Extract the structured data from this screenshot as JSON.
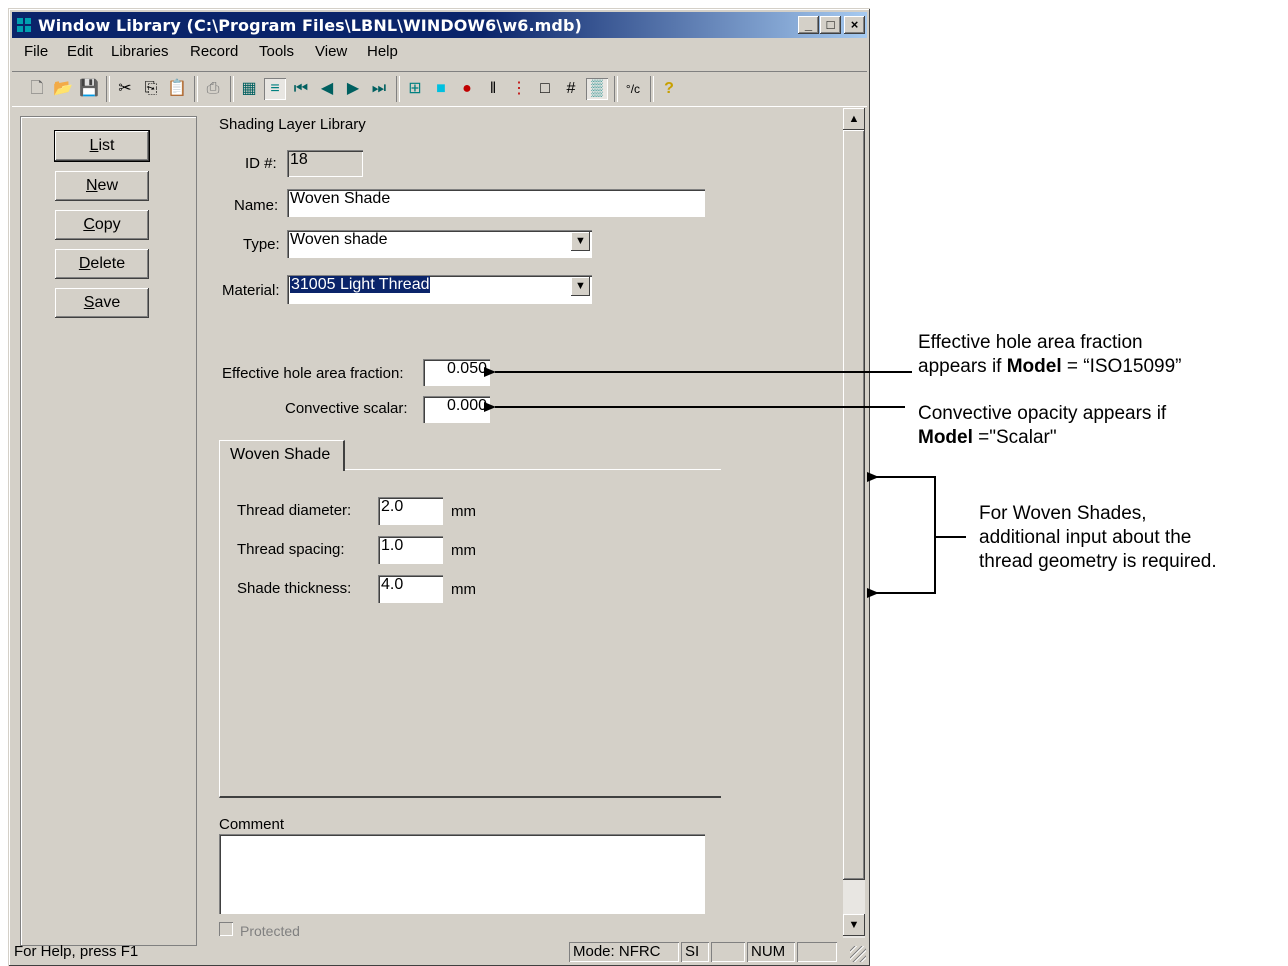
{
  "window": {
    "title": "Window Library (C:\\Program Files\\LBNL\\WINDOW6\\w6.mdb)",
    "min_label": "_",
    "max_label": "□",
    "close_label": "×"
  },
  "menu": [
    "File",
    "Edit",
    "Libraries",
    "Record",
    "Tools",
    "View",
    "Help"
  ],
  "toolbar_icons": [
    "new-file-icon",
    "open-folder-icon",
    "save-icon",
    "cut-icon",
    "copy-icon",
    "paste-icon",
    "print-icon",
    "grid-view-icon",
    "list-view-icon",
    "first-record-icon",
    "prev-record-icon",
    "next-record-icon",
    "last-record-icon",
    "glazing-icon",
    "color-icon",
    "pin-icon",
    "columns-icon",
    "marker-icon",
    "frame-icon",
    "hash-icon",
    "shade-icon",
    "temperature-unit-icon",
    "help-icon"
  ],
  "left_buttons": {
    "list": {
      "u": "L",
      "rest": "ist"
    },
    "new": {
      "u": "N",
      "rest": "ew"
    },
    "copy": {
      "u": "C",
      "rest": "opy"
    },
    "delete": {
      "u": "D",
      "rest": "elete"
    },
    "save": {
      "u": "S",
      "rest": "ave"
    }
  },
  "form": {
    "section_title": "Shading Layer Library",
    "id_label": "ID #:",
    "id_value": "18",
    "name_label": "Name:",
    "name_value": "Woven Shade",
    "type_label": "Type:",
    "type_value": "Woven shade",
    "material_label": "Material:",
    "material_value": "31005 Light Thread",
    "hole_fraction_label": "Effective hole area fraction:",
    "hole_fraction_value": "0.050",
    "convective_label": "Convective scalar:",
    "convective_value": "0.000"
  },
  "tab": {
    "label": "Woven Shade",
    "thread_diameter_label": "Thread diameter:",
    "thread_diameter_value": "2.0",
    "thread_spacing_label": "Thread spacing:",
    "thread_spacing_value": "1.0",
    "shade_thickness_label": "Shade thickness:",
    "shade_thickness_value": "4.0",
    "unit": "mm"
  },
  "comment": {
    "label": "Comment",
    "value": "",
    "protected_label": "Protected"
  },
  "status": {
    "help": "For Help, press F1",
    "mode": "Mode: NFRC",
    "units": "SI",
    "num": "NUM"
  },
  "annotations": {
    "hole_line1": "Effective hole area fraction",
    "hole_line2_pre": "appears if ",
    "hole_line2_bold": "Model",
    "hole_line2_post": " = “ISO15099”",
    "conv_line1": "Convective opacity appears if",
    "conv_line2_bold": "Model",
    "conv_line2_post": " =\"Scalar\"",
    "woven_line1": "For Woven Shades,",
    "woven_line2": "additional input about the",
    "woven_line3": "thread geometry is required."
  }
}
